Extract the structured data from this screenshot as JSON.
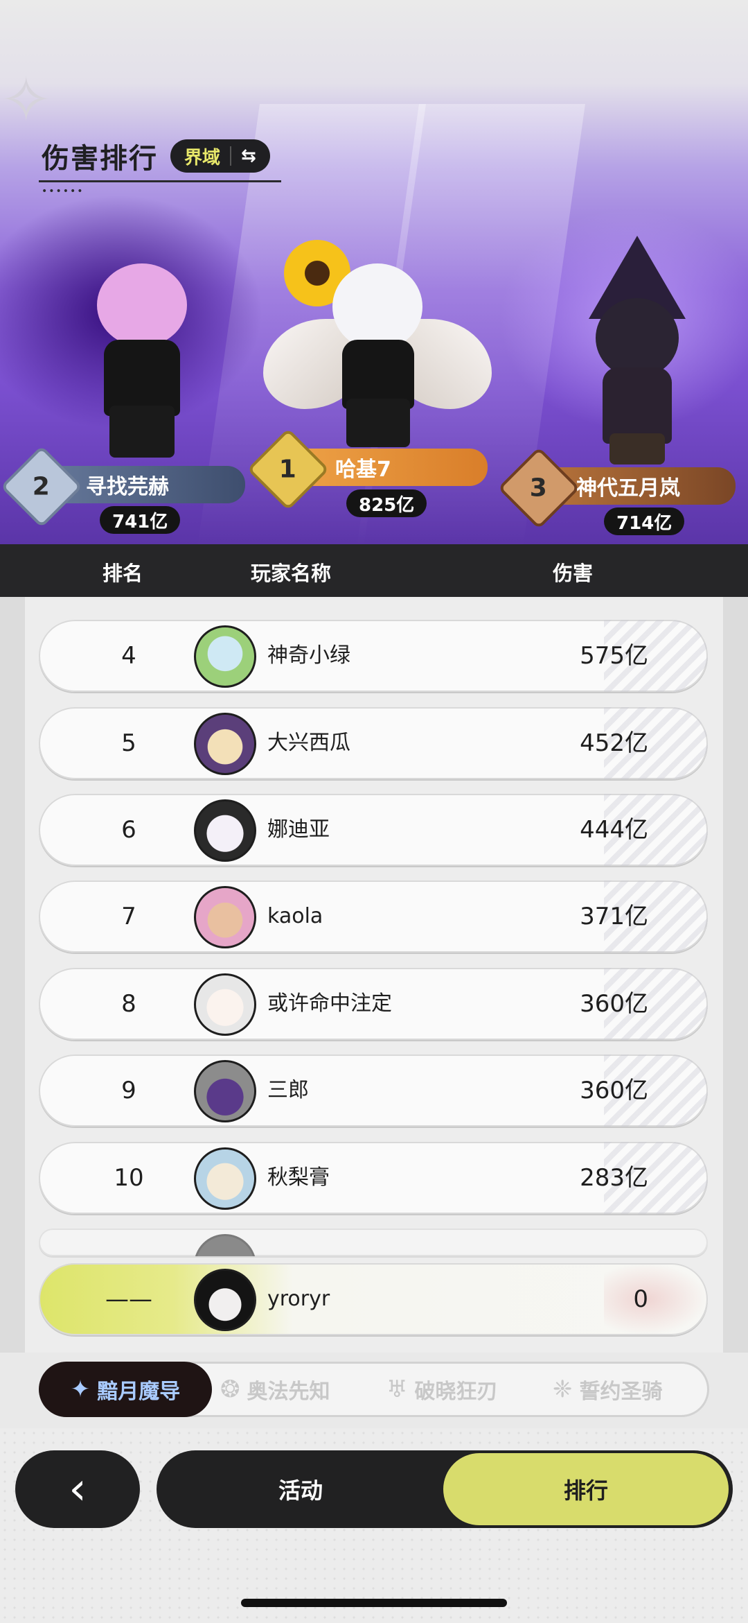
{
  "header": {
    "title": "伤害排行",
    "realm_label": "界域",
    "swap_icon": "swap-arrows-icon"
  },
  "podium": [
    {
      "rank": "2",
      "name": "寻找芫赫",
      "score": "741亿"
    },
    {
      "rank": "1",
      "name": "哈基7",
      "score": "825亿"
    },
    {
      "rank": "3",
      "name": "神代五月岚",
      "score": "714亿"
    }
  ],
  "table": {
    "col_rank": "排名",
    "col_player": "玩家名称",
    "col_damage": "伤害"
  },
  "rows": [
    {
      "rank": "4",
      "name": "神奇小绿",
      "damage": "575亿"
    },
    {
      "rank": "5",
      "name": "大兴西瓜",
      "damage": "452亿"
    },
    {
      "rank": "6",
      "name": "娜迪亚",
      "damage": "444亿"
    },
    {
      "rank": "7",
      "name": "kaola",
      "damage": "371亿"
    },
    {
      "rank": "8",
      "name": "或许命中注定",
      "damage": "360亿"
    },
    {
      "rank": "9",
      "name": "三郎",
      "damage": "360亿"
    },
    {
      "rank": "10",
      "name": "秋梨膏",
      "damage": "283亿"
    }
  ],
  "my_row": {
    "rank": "——",
    "name": "yroryr",
    "damage": "0"
  },
  "class_tabs": [
    {
      "label": "黯月魔导",
      "icon": "moon-mage-icon",
      "active": true
    },
    {
      "label": "奥法先知",
      "icon": "arcane-icon",
      "active": false
    },
    {
      "label": "破晓狂刃",
      "icon": "blade-icon",
      "active": false
    },
    {
      "label": "誓约圣骑",
      "icon": "winged-shield-icon",
      "active": false
    }
  ],
  "nav": {
    "back_icon": "chevron-left-icon",
    "activity_label": "活动",
    "ranking_label": "排行"
  },
  "colors": {
    "accent": "#d8dc6c",
    "dark": "#212122",
    "active_tab_text": "#a9cbff"
  }
}
